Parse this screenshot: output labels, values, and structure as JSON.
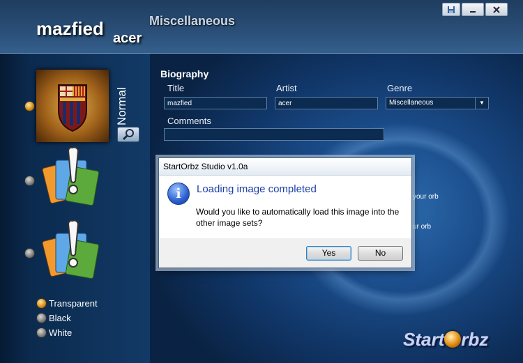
{
  "window": {
    "app_name": "mazfied",
    "app_sub": "acer",
    "section_title": "Miscellaneous",
    "buttons": [
      "save-icon",
      "minimize-icon",
      "close-icon"
    ]
  },
  "sidebar": {
    "normal_label": "Normal",
    "image_sets": [
      {
        "name": "normal",
        "selected": true
      },
      {
        "name": "hover",
        "selected": false
      },
      {
        "name": "pressed",
        "selected": false
      }
    ],
    "background_options": [
      {
        "label": "Transparent",
        "selected": true
      },
      {
        "label": "Black",
        "selected": false
      },
      {
        "label": "White",
        "selected": false
      }
    ]
  },
  "biography": {
    "heading": "Biography",
    "title_label": "Title",
    "title_value": "mazfied",
    "artist_label": "Artist",
    "artist_value": "acer",
    "genre_label": "Genre",
    "genre_value": "Miscellaneous",
    "comments_label": "Comments",
    "comments_value": ""
  },
  "background_text": {
    "line1": "your orb",
    "line2": "ur orb"
  },
  "logo": {
    "part1": "Start",
    "part2": "rbz"
  },
  "dialog": {
    "title": "StartOrbz Studio v1.0a",
    "icon": "info-icon",
    "heading": "Loading image completed",
    "message": "Would you like to automatically load this image into the other image sets?",
    "yes_label": "Yes",
    "no_label": "No"
  }
}
